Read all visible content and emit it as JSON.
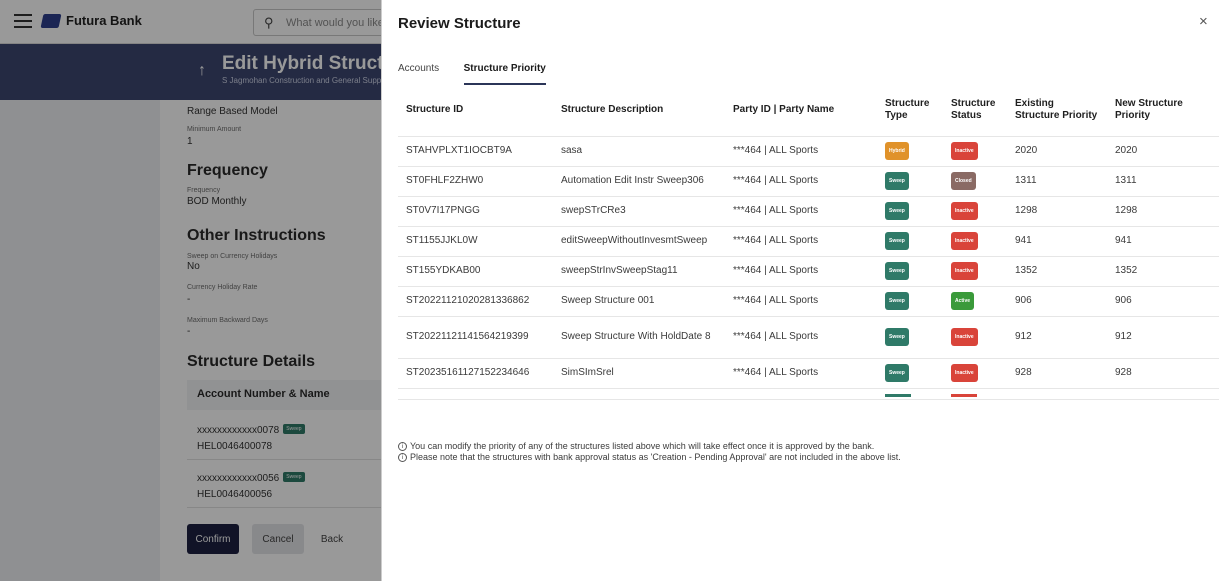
{
  "app": {
    "brand_name": "Futura Bank",
    "search_placeholder": "What would you like to do today?"
  },
  "hero": {
    "title": "Edit Hybrid Structure",
    "subtitle": "S Jagmohan Construction and General Supplies"
  },
  "background": {
    "range_model": "Range Based Model",
    "minimum_amount_label": "Minimum Amount",
    "minimum_amount_value": "1",
    "frequency_title": "Frequency",
    "frequency_label": "Frequency",
    "frequency_value": "BOD Monthly",
    "other_title": "Other Instructions",
    "sweep_holidays_label": "Sweep on Currency Holidays",
    "sweep_holidays_value": "No",
    "holiday_rate_label": "Currency Holiday Rate",
    "holiday_rate_value": "-",
    "max_backward_label": "Maximum Backward Days",
    "max_backward_value": "-",
    "structure_details_title": "Structure Details",
    "account_header": "Account Number & Name",
    "accounts": [
      {
        "number": "xxxxxxxxxxxx0078",
        "tag": "Sweep",
        "name": "HEL0046400078"
      },
      {
        "number": "xxxxxxxxxxxx0056",
        "tag": "Sweep",
        "name": "HEL0046400056"
      }
    ],
    "confirm_label": "Confirm",
    "cancel_label": "Cancel",
    "back_label": "Back"
  },
  "modal": {
    "title": "Review Structure",
    "close_glyph": "×",
    "tabs": [
      {
        "label": "Accounts",
        "active": false
      },
      {
        "label": "Structure Priority",
        "active": true
      }
    ],
    "columns": [
      "Structure ID",
      "Structure Description",
      "Party ID | Party Name",
      "Structure Type",
      "Structure Status",
      "Existing Structure Priority",
      "New Structure Priority"
    ],
    "rows": [
      {
        "id": "STAHVPLXT1IOCBT9A",
        "desc": "sasa",
        "party": "***464 | ALL Sports",
        "type": "Hybrid",
        "status": "Inactive",
        "existing": "2020",
        "new": "2020"
      },
      {
        "id": "ST0FHLF2ZHW0",
        "desc": "Automation Edit Instr Sweep306",
        "party": "***464 | ALL Sports",
        "type": "Sweep",
        "status": "Closed",
        "existing": "1311",
        "new": "1311"
      },
      {
        "id": "ST0V7I17PNGG",
        "desc": "swepSTrCRe3",
        "party": "***464 | ALL Sports",
        "type": "Sweep",
        "status": "Inactive",
        "existing": "1298",
        "new": "1298"
      },
      {
        "id": "ST1155JJKL0W",
        "desc": "editSweepWithoutInvesmtSweep",
        "party": "***464 | ALL Sports",
        "type": "Sweep",
        "status": "Inactive",
        "existing": "941",
        "new": "941"
      },
      {
        "id": "ST155YDKAB00",
        "desc": "sweepStrInvSweepStag11",
        "party": "***464 | ALL Sports",
        "type": "Sweep",
        "status": "Inactive",
        "existing": "1352",
        "new": "1352"
      },
      {
        "id": "ST20221121020281336862",
        "desc": "Sweep Structure 001",
        "party": "***464 | ALL Sports",
        "type": "Sweep",
        "status": "Active",
        "existing": "906",
        "new": "906"
      },
      {
        "id": "ST20221121141564219399",
        "desc": "Sweep Structure With HoldDate 8",
        "party": "***464 | ALL Sports",
        "type": "Sweep",
        "status": "Inactive",
        "existing": "912",
        "new": "912"
      },
      {
        "id": "ST20235161127152234646",
        "desc": "SimSImSrel",
        "party": "***464 | ALL Sports",
        "type": "Sweep",
        "status": "Inactive",
        "existing": "928",
        "new": "928"
      }
    ],
    "notes": [
      "You can modify the priority of any of the structures listed above which will take effect once it is approved by the bank.",
      "Please note that the structures with bank approval status as 'Creation - Pending Approval' are not included in the above list."
    ]
  },
  "colors": {
    "hybrid": "#e0922a",
    "sweep": "#2f7a68",
    "inactive": "#d9443a",
    "closed": "#8a6a64",
    "active": "#3a9a3a",
    "hero": "#3c4770",
    "primary_button": "#1d2142"
  }
}
